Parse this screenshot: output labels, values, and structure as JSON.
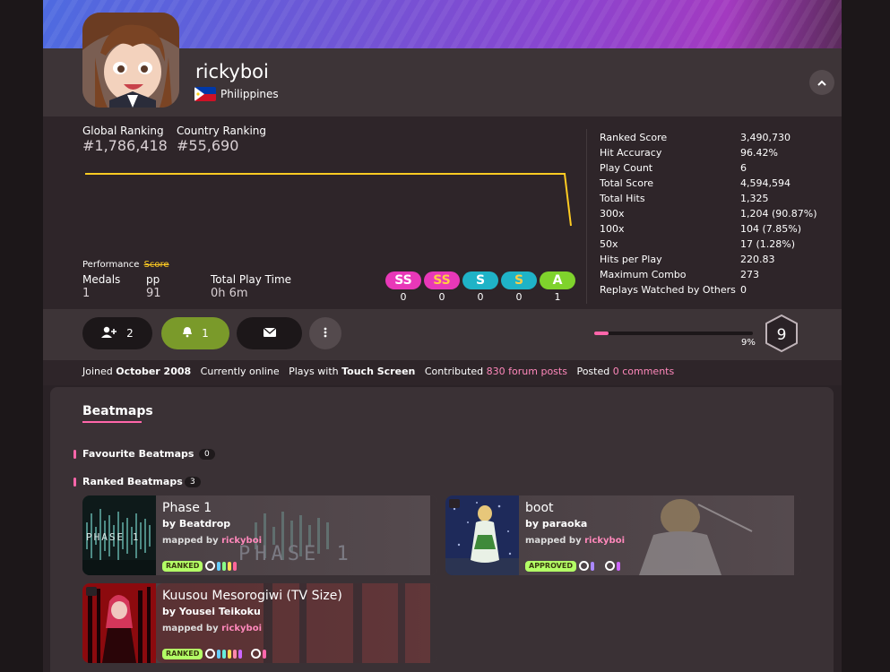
{
  "profile": {
    "username": "rickyboi",
    "country": "Philippines"
  },
  "ranking": {
    "global_label": "Global Ranking",
    "global_value": "#1,786,418",
    "country_label": "Country Ranking",
    "country_value": "#55,690"
  },
  "tabs": {
    "performance": "Performance",
    "score": "Score"
  },
  "mini_stats": [
    {
      "label": "Medals",
      "value": "1"
    },
    {
      "label": "pp",
      "value": "91"
    },
    {
      "label": "Total Play Time",
      "value": "0h 6m"
    }
  ],
  "grades": [
    {
      "letter": "SS",
      "count": "0",
      "color": "#e838b8",
      "text": "#fff"
    },
    {
      "letter": "SS",
      "count": "0",
      "color": "#e838b8",
      "text": "#ffcc44"
    },
    {
      "letter": "S",
      "count": "0",
      "color": "#1fb3c7",
      "text": "#fff"
    },
    {
      "letter": "S",
      "count": "0",
      "color": "#1fb3c7",
      "text": "#ffcc44"
    },
    {
      "letter": "A",
      "count": "1",
      "color": "#7fd32c",
      "text": "#fff"
    }
  ],
  "details": [
    {
      "k": "Ranked Score",
      "v": "3,490,730"
    },
    {
      "k": "Hit Accuracy",
      "v": "96.42%"
    },
    {
      "k": "Play Count",
      "v": "6"
    },
    {
      "k": "Total Score",
      "v": "4,594,594"
    },
    {
      "k": "Total Hits",
      "v": "1,325"
    },
    {
      "k": "300x",
      "v": "1,204 (90.87%)"
    },
    {
      "k": "100x",
      "v": "104 (7.85%)"
    },
    {
      "k": "50x",
      "v": "17 (1.28%)"
    },
    {
      "k": "Hits per Play",
      "v": "220.83"
    },
    {
      "k": "Maximum Combo",
      "v": "273"
    },
    {
      "k": "Replays Watched by Others",
      "v": "0"
    }
  ],
  "actions": {
    "followers": "2",
    "subscribers": "1"
  },
  "level": {
    "value": "9",
    "progress_label": "9%",
    "progress": 0.09
  },
  "joined": {
    "joined_prefix": "Joined",
    "joined_date": "October 2008",
    "online": "Currently online",
    "plays_prefix": "Plays with",
    "plays_device": "Touch Screen",
    "contributed_prefix": "Contributed",
    "forum_posts": "830 forum posts",
    "posted_prefix": "Posted",
    "comments": "0 comments"
  },
  "beatmaps": {
    "section_title": "Beatmaps",
    "favourite_label": "Favourite Beatmaps",
    "favourite_count": "0",
    "ranked_label": "Ranked Beatmaps",
    "ranked_count": "3",
    "mapped_by": "mapped by",
    "cards": [
      {
        "title": "Phase 1",
        "artist": "by Beatdrop",
        "mapper": "rickyboi",
        "status": "RANKED"
      },
      {
        "title": "boot",
        "artist": "by paraoka",
        "mapper": "rickyboi",
        "status": "APPROVED"
      },
      {
        "title": "Kuusou Mesorogiwi (TV Size)",
        "artist": "by Yousei Teikoku",
        "mapper": "rickyboi",
        "status": "RANKED"
      }
    ]
  },
  "colors": {
    "accent_pink": "#ff66aa",
    "graph_line": "#ffcc22",
    "ranked_badge": "#b3ff66",
    "follow_active": "#7a9a2a"
  }
}
